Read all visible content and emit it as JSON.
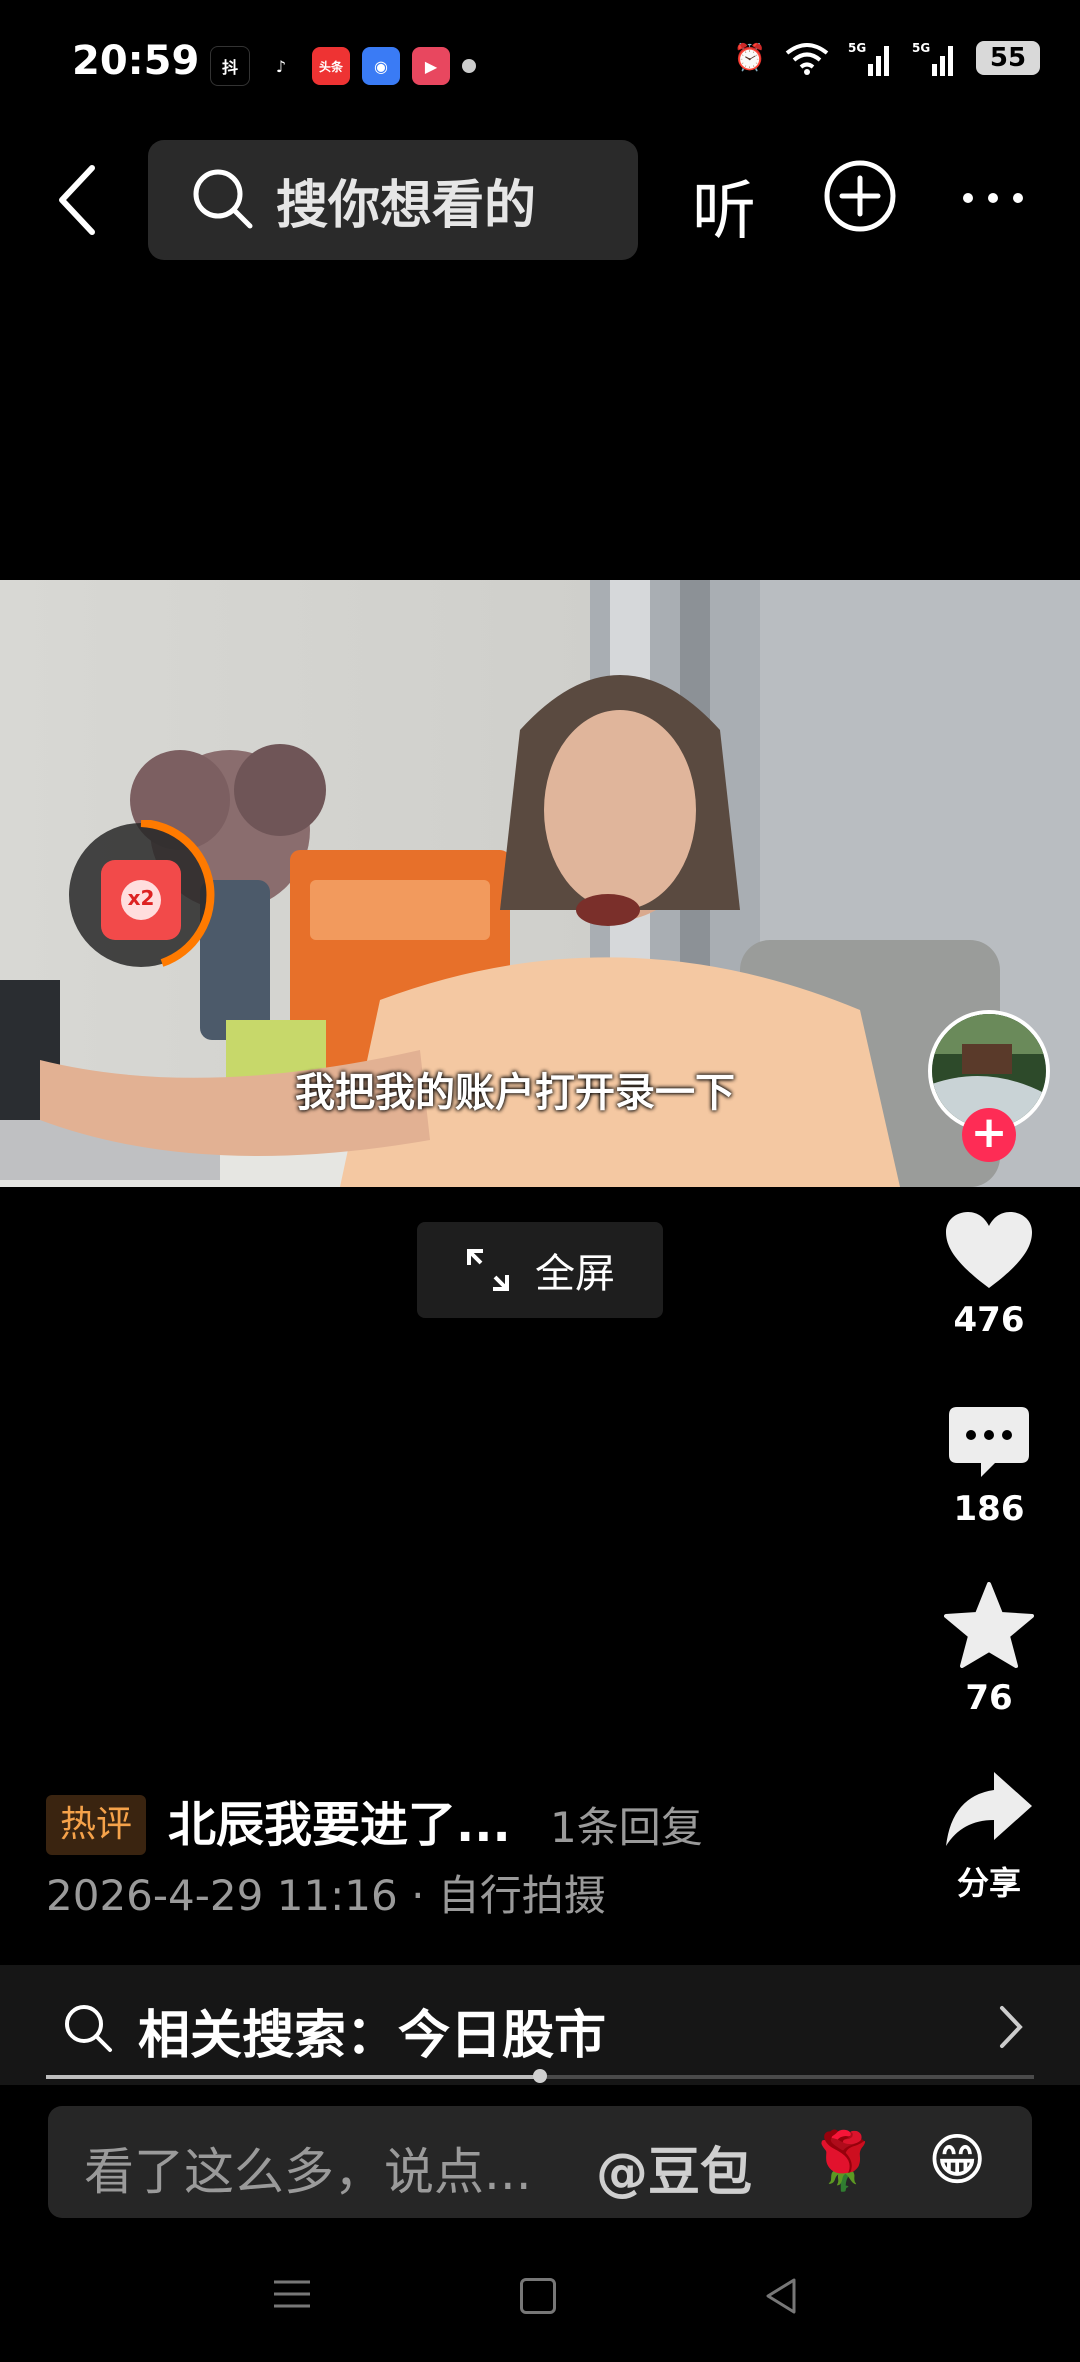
{
  "status_bar": {
    "time": "20:59",
    "app_icons": [
      "抖",
      "♪",
      "头条",
      "◉",
      "▶"
    ],
    "network": "5G 5G",
    "battery": "55"
  },
  "top_bar": {
    "search_placeholder": "搜你想看的",
    "listen_label": "听"
  },
  "video": {
    "subtitle": "我把我的账户打开录一下",
    "redpacket_label": "x2"
  },
  "fullscreen_label": "全屏",
  "actions": {
    "like_count": "476",
    "comment_count": "186",
    "favorite_count": "76",
    "share_label": "分享"
  },
  "hot_comment": {
    "badge": "热评",
    "text": "北辰我要进了...",
    "replies": "1条回复"
  },
  "meta": "2026-4-29 11:16 · 自行拍摄",
  "related_search": {
    "label": "相关搜索：今日股市"
  },
  "progress": {
    "fraction": 0.5
  },
  "comment_input": {
    "placeholder": "看了这么多，说点...",
    "mention": "@豆包",
    "emoji1": "🌹",
    "emoji2": "😁"
  },
  "colors": {
    "accent": "#fe2c55",
    "hot_badge": "#f5a24a"
  }
}
